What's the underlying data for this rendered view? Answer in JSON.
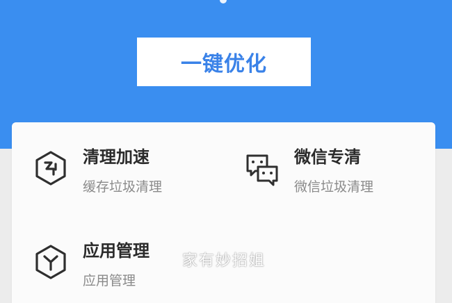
{
  "colors": {
    "header_bg": "#3a8ef0",
    "button_text": "#3a82e8",
    "card_bg": "#fbfbfb",
    "title_text": "#2a2a2a",
    "subtitle_text": "#8a8a8a"
  },
  "header": {
    "optimize_button_label": "一键优化"
  },
  "features": [
    {
      "title": "清理加速",
      "subtitle": "缓存垃圾清理",
      "icon": "cleanup-hexagon-icon"
    },
    {
      "title": "微信专清",
      "subtitle": "微信垃圾清理",
      "icon": "wechat-chat-icon"
    },
    {
      "title": "应用管理",
      "subtitle": "应用管理",
      "icon": "app-hexagon-icon"
    }
  ],
  "watermark": "家有妙招姐"
}
